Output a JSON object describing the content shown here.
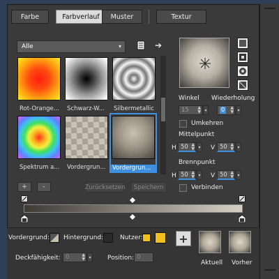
{
  "tabs": [
    {
      "label": "Farbe"
    },
    {
      "label": "Farbverlauf",
      "active": true
    },
    {
      "label": "Muster"
    },
    {
      "label": "Textur"
    }
  ],
  "category_dropdown": {
    "value": "Alle"
  },
  "thumbnails": [
    {
      "label": "Rot-Orange...",
      "style": "red-orange-radial"
    },
    {
      "label": "Schwarz-W...",
      "style": "black-white-radial"
    },
    {
      "label": "Silbermetallic",
      "style": "silver-rings"
    },
    {
      "label": "Spektrum a...",
      "style": "spectrum-concentric"
    },
    {
      "label": "Vordergrun...",
      "style": "checker-transparent"
    },
    {
      "label": "Vordergrun...",
      "style": "tan-radial",
      "selected": true
    }
  ],
  "gradient_buttons": {
    "add": "+",
    "remove": "-",
    "reset": "Zurücksetzen",
    "save": "Speichern"
  },
  "angle": {
    "label": "Winkel",
    "value": "15"
  },
  "repetition": {
    "label": "Wiederholung",
    "value": "0"
  },
  "invert": {
    "label": "Umkehren",
    "checked": false
  },
  "center": {
    "label": "Mittelpunkt",
    "h_label": "H",
    "h_value": "50",
    "v_label": "V",
    "v_value": "50"
  },
  "focus": {
    "label": "Brennpunkt",
    "h_label": "H",
    "h_value": "50",
    "v_label": "V",
    "v_value": "50"
  },
  "link": {
    "label": "Verbinden",
    "checked": false
  },
  "bottom": {
    "foreground_label": "Vordergrund:",
    "background_label": "Hintergrund:",
    "user_label": "Nutzer:",
    "opacity_label": "Deckfähigkeit:",
    "opacity_value": "0",
    "position_label": "Position:",
    "position_value": "0",
    "current_label": "Aktuell",
    "previous_label": "Vorher",
    "add_symbol": "+"
  },
  "colors": {
    "accent": "#3d8fe0",
    "panel": "#3a3a3a",
    "window_bg": "#2f3f57",
    "user_swatch": "#f0c020"
  }
}
